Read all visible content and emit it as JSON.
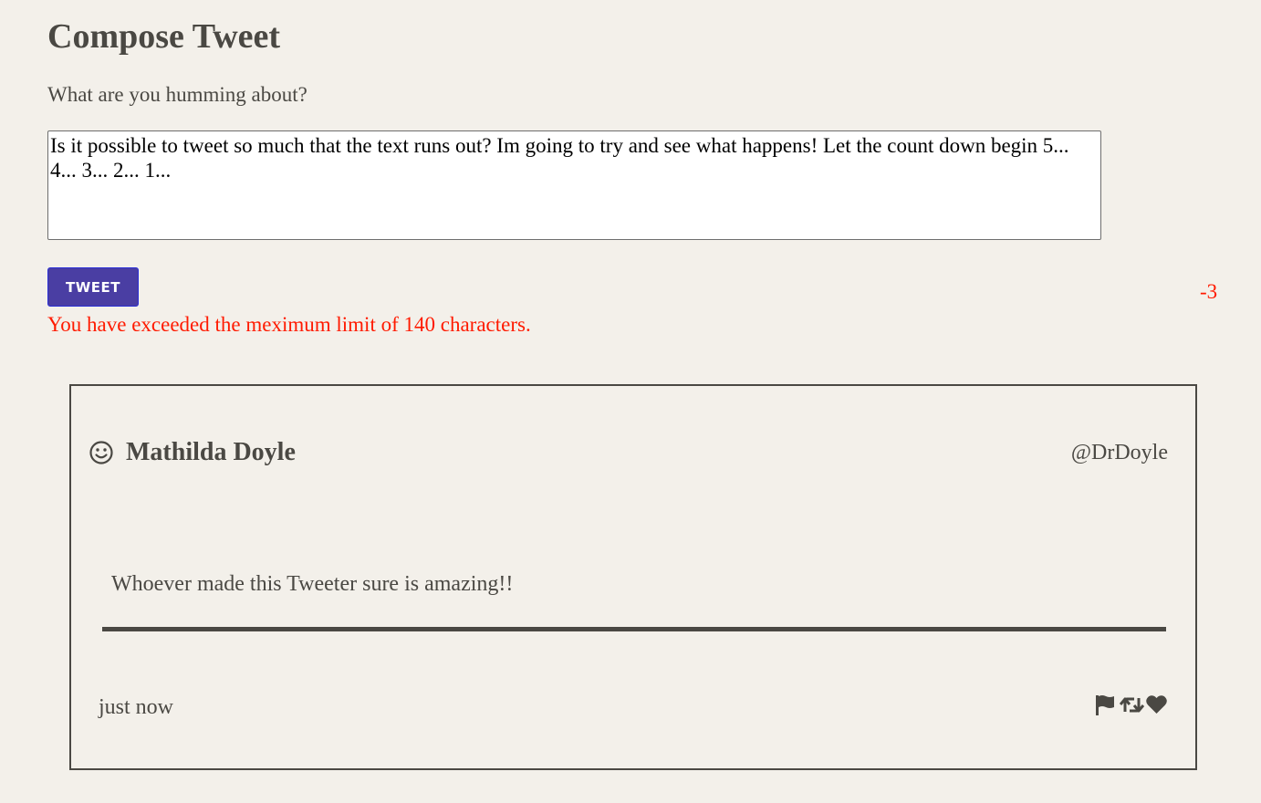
{
  "compose": {
    "title": "Compose Tweet",
    "label": "What are you humming about?",
    "textarea_value": "Is it possible to tweet so much that the text runs out? Im going to try and see what happens! Let the count down begin 5... 4... 3... 2... 1...",
    "button_label": "TWEET",
    "counter": "-3",
    "error": "You have exceeded the meximum limit of 140 characters."
  },
  "tweet": {
    "author_name": "Mathilda Doyle",
    "handle": "@DrDoyle",
    "body": "Whoever made this Tweeter sure is amazing!!",
    "timestamp": "just now",
    "avatar_icon": "smiley-face-icon",
    "actions": [
      "flag-icon",
      "retweet-icon",
      "heart-icon"
    ]
  },
  "colors": {
    "background": "#f3f0ea",
    "text": "#4a4843",
    "error": "#ff1a00",
    "button": "#4a3ea3",
    "button_border": "#2a2fd6"
  }
}
